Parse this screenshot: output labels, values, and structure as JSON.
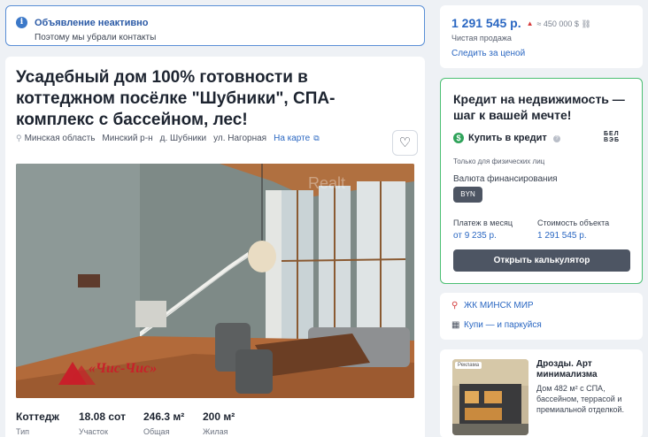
{
  "notice": {
    "title": "Объявление неактивно",
    "subtitle": "Поэтому мы убрали контакты"
  },
  "listing": {
    "title": "Усадебный дом 100% готовности в коттеджном посёлке \"Шубники\", СПА-комплекс с бассейном, лес!",
    "address": [
      "Минская область",
      "Минский р-н",
      "д. Шубники",
      "ул. Нагорная"
    ],
    "map_link": "На карте",
    "photo_watermark": "Realt",
    "photo_logo": "«Чис-Чис»",
    "stats": [
      {
        "value": "Коттедж",
        "label": "Тип"
      },
      {
        "value": "18.08 сот",
        "label": "Участок"
      },
      {
        "value": "246.3 м²",
        "label": "Общая"
      },
      {
        "value": "200 м²",
        "label": "Жилая"
      }
    ]
  },
  "price": {
    "byn": "1 291 545 р.",
    "usd": "≈ 450 000 $",
    "sale_type": "Чистая продажа",
    "follow_link": "Следить за ценой"
  },
  "credit": {
    "title": "Кредит на недвижимость — шаг к вашей мечте!",
    "buy_label": "Купить в кредит",
    "bank_logo": "БЕЛ ВЭБ",
    "note": "Только для физических лиц",
    "currency_label": "Валюта финансирования",
    "currency": "BYN",
    "monthly_label": "Платеж в месяц",
    "monthly_value": "от 9 235 р.",
    "cost_label": "Стоимость объекта",
    "cost_value": "1 291 545 р.",
    "calc_button": "Открыть калькулятор"
  },
  "links": {
    "complex": "ЖК МИНСК МИР",
    "parking": "Купи — и паркуйся"
  },
  "ad": {
    "badge": "Реклама",
    "title": "Дрозды. Арт минимализма",
    "text": "Дом 482 м² с СПА, бассейном, террасой и премиальной отделкой."
  },
  "colors": {
    "accent": "#2a67c2",
    "credit_border": "#4bbf73",
    "dark_button": "#4d5563",
    "price_up": "#d63b3b"
  }
}
